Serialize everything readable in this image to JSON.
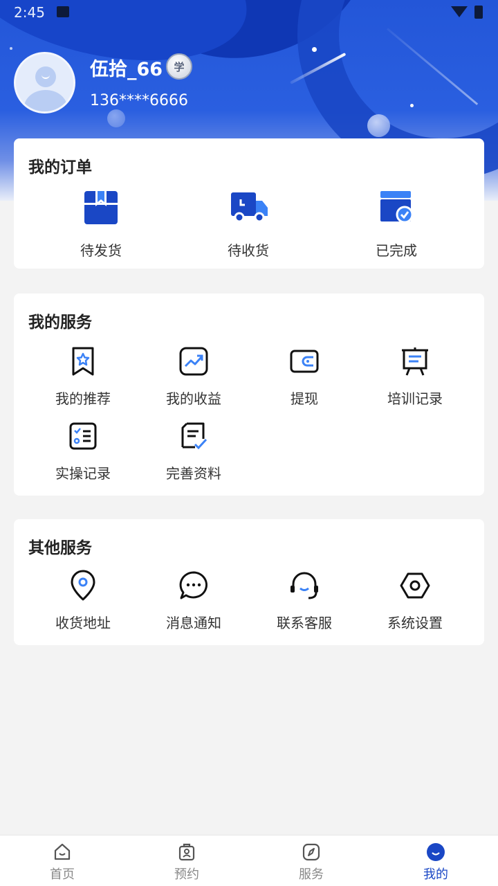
{
  "status_bar": {
    "time": "2:45"
  },
  "profile": {
    "name": "伍拾_66",
    "badge": "学",
    "phone": "136****6666"
  },
  "orders": {
    "title": "我的订单",
    "items": [
      {
        "label": "待发货",
        "icon": "package-icon"
      },
      {
        "label": "待收货",
        "icon": "truck-icon"
      },
      {
        "label": "已完成",
        "icon": "completed-box-icon"
      }
    ]
  },
  "services": {
    "title": "我的服务",
    "items": [
      {
        "label": "我的推荐",
        "icon": "bookmark-star-icon"
      },
      {
        "label": "我的收益",
        "icon": "trend-chart-icon"
      },
      {
        "label": "提现",
        "icon": "wallet-icon"
      },
      {
        "label": "培训记录",
        "icon": "presentation-board-icon"
      },
      {
        "label": "实操记录",
        "icon": "checklist-icon"
      },
      {
        "label": "完善资料",
        "icon": "document-check-icon"
      }
    ]
  },
  "other": {
    "title": "其他服务",
    "items": [
      {
        "label": "收货地址",
        "icon": "location-pin-icon"
      },
      {
        "label": "消息通知",
        "icon": "chat-bubble-icon"
      },
      {
        "label": "联系客服",
        "icon": "headset-icon"
      },
      {
        "label": "系统设置",
        "icon": "settings-hexagon-icon"
      }
    ]
  },
  "tabbar": {
    "active": "我的",
    "tabs": [
      {
        "label": "首页",
        "icon": "home-icon"
      },
      {
        "label": "预约",
        "icon": "appointment-icon"
      },
      {
        "label": "服务",
        "icon": "compass-icon"
      },
      {
        "label": "我的",
        "icon": "profile-smile-icon"
      }
    ]
  },
  "colors": {
    "primary": "#1a47c5",
    "accent_light": "#3b82f6",
    "background": "#f3f3f3"
  }
}
